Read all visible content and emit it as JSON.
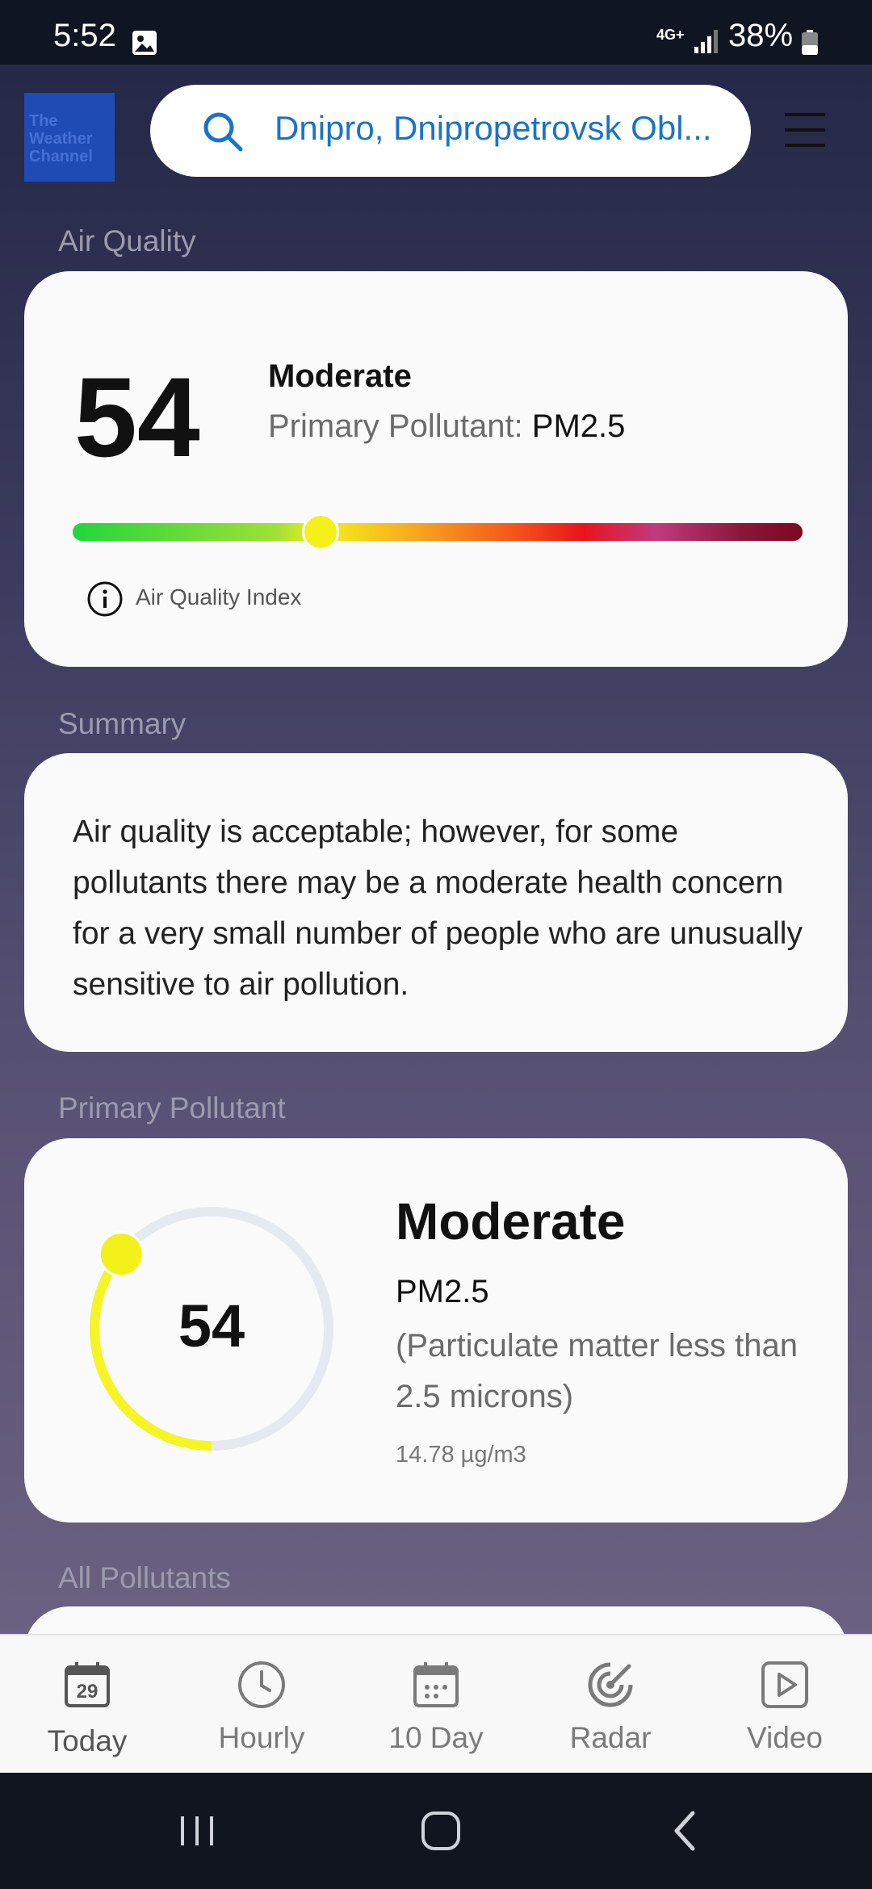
{
  "status_bar": {
    "time": "5:52",
    "network": "4G+",
    "battery": "38%"
  },
  "header": {
    "logo_text": "The Weather Channel",
    "search_value": "Dnipro, Dnipropetrovsk Obl..."
  },
  "air_quality": {
    "section_label": "Air Quality",
    "aqi": "54",
    "category": "Moderate",
    "primary_pollutant_label": "Primary Pollutant:",
    "primary_pollutant_value": "PM2.5",
    "scale_position": 0.34,
    "index_label": "Air Quality Index"
  },
  "summary": {
    "section_label": "Summary",
    "text": "Air quality is acceptable; however, for some pollutants there may be a moderate health concern for a very small number of people who are unusually sensitive to air pollution."
  },
  "primary_pollutant": {
    "section_label": "Primary Pollutant",
    "value": "54",
    "gauge_fraction": 0.36,
    "category": "Moderate",
    "code": "PM2.5",
    "description": "(Particulate matter less than 2.5 microns)",
    "concentration": "14.78 µg/m3"
  },
  "all_pollutants": {
    "section_label": "All Pollutants"
  },
  "bottom_nav": [
    {
      "label": "Today",
      "icon": "calendar-day-icon",
      "badge": "29"
    },
    {
      "label": "Hourly",
      "icon": "clock-icon"
    },
    {
      "label": "10 Day",
      "icon": "calendar-icon"
    },
    {
      "label": "Radar",
      "icon": "radar-icon"
    },
    {
      "label": "Video",
      "icon": "play-icon"
    }
  ],
  "colors": {
    "accent": "#1a73c8",
    "aqi_marker": "#f3f01a",
    "gauge_arc": "#f5f526",
    "gauge_track": "#e6eaef"
  }
}
